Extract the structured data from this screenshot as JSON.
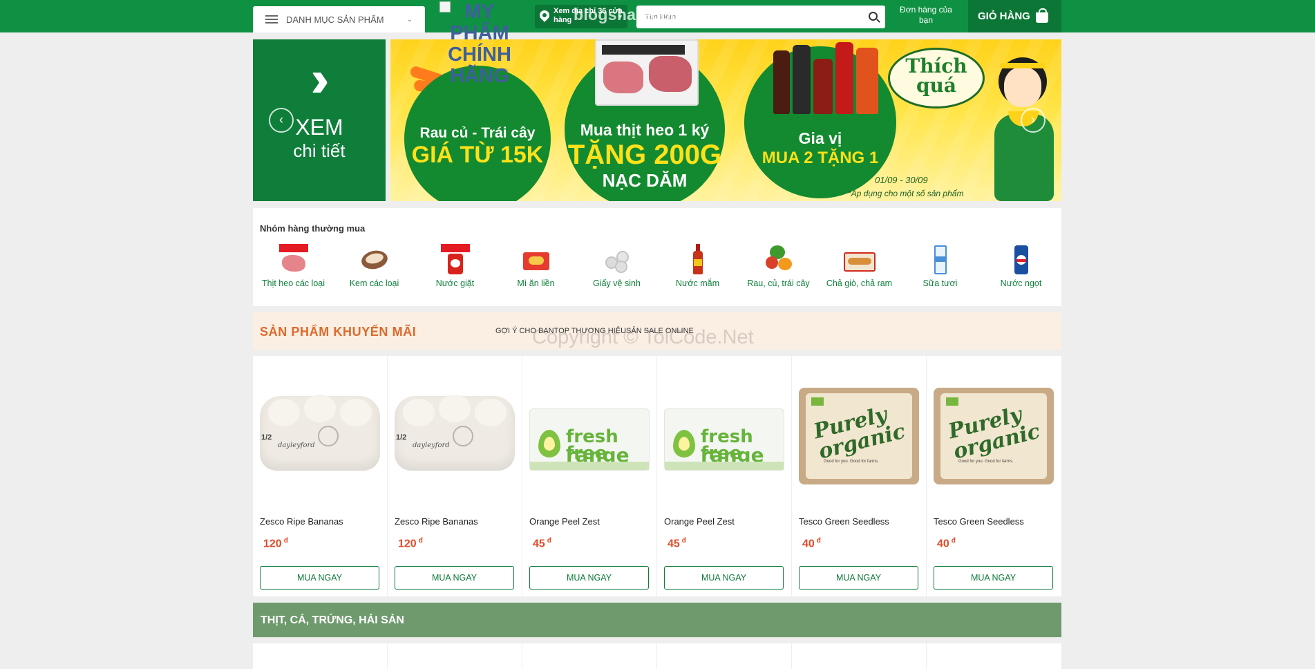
{
  "header": {
    "category_menu_label": "DANH MỤC SẢN PHẨM",
    "logo_text": "MY PHẨM CHÍNH HÃNG",
    "store_button": "Xem địa chỉ 36 cửa hàng",
    "watermark": "blogsharecode.com",
    "search_placeholder": "Tìm kiếm",
    "orders_label": "Đơn hàng của bạn",
    "cart_label": "GIỎ HÀNG"
  },
  "banner": {
    "left_line1": "XEM",
    "left_line2": "chi tiết",
    "promo1_line1": "Rau củ - Trái cây",
    "promo1_line2": "GIÁ TỪ 15K",
    "promo2_line1": "Mua thịt heo 1 ký",
    "promo2_line2": "TẶNG 200G",
    "promo2_line3": "NẠC DĂM",
    "promo3_line1": "Gia vị",
    "promo3_line2": "MUA 2 TẶNG 1",
    "slogan": "Thích quá",
    "dates": "01/09 - 30/09",
    "note": "*Áp dụng cho một số sản phẩm"
  },
  "frequent": {
    "title": "Nhóm hàng thường mua",
    "items": [
      {
        "label": "Thịt heo các loại",
        "icon": "pork-icon"
      },
      {
        "label": "Kem các loại",
        "icon": "ice-cream-icon"
      },
      {
        "label": "Nước giặt",
        "icon": "detergent-icon"
      },
      {
        "label": "Mì ăn liền",
        "icon": "instant-noodle-icon"
      },
      {
        "label": "Giấy vệ sinh",
        "icon": "toilet-paper-icon"
      },
      {
        "label": "Nước mắm",
        "icon": "fish-sauce-icon"
      },
      {
        "label": "Rau, củ, trái cây",
        "icon": "vegetables-icon"
      },
      {
        "label": "Chả giò, chả ram",
        "icon": "spring-roll-icon"
      },
      {
        "label": "Sữa tươi",
        "icon": "milk-icon"
      },
      {
        "label": "Nước ngọt",
        "icon": "soda-can-icon"
      }
    ]
  },
  "promo": {
    "title": "SẢN PHẨM KHUYẾN MÃI",
    "tabs": [
      "GỢI Ý CHO BẠN",
      "TOP THƯƠNG HIỆU",
      "SẢN SALE ONLINE"
    ],
    "watermark": "Copyright © ToiCode.Net",
    "buy_label": "MUA NGAY",
    "currency": "đ",
    "products": [
      {
        "name": "Zesco Ripe Bananas",
        "price": "120"
      },
      {
        "name": "Zesco Ripe Bananas",
        "price": "120"
      },
      {
        "name": "Orange Peel Zest",
        "price": "45"
      },
      {
        "name": "Orange Peel Zest",
        "price": "45"
      },
      {
        "name": "Tesco Green Seedless",
        "price": "40"
      },
      {
        "name": "Tesco Green Seedless",
        "price": "40"
      }
    ]
  },
  "meat_section": {
    "title": "THỊT, CÁ, TRỨNG, HẢI SẢN"
  },
  "colors": {
    "brand_green": "#0f9143",
    "dark_green": "#0b7636",
    "promo_orange": "#dc6b2c",
    "price_red": "#e24a2a"
  }
}
